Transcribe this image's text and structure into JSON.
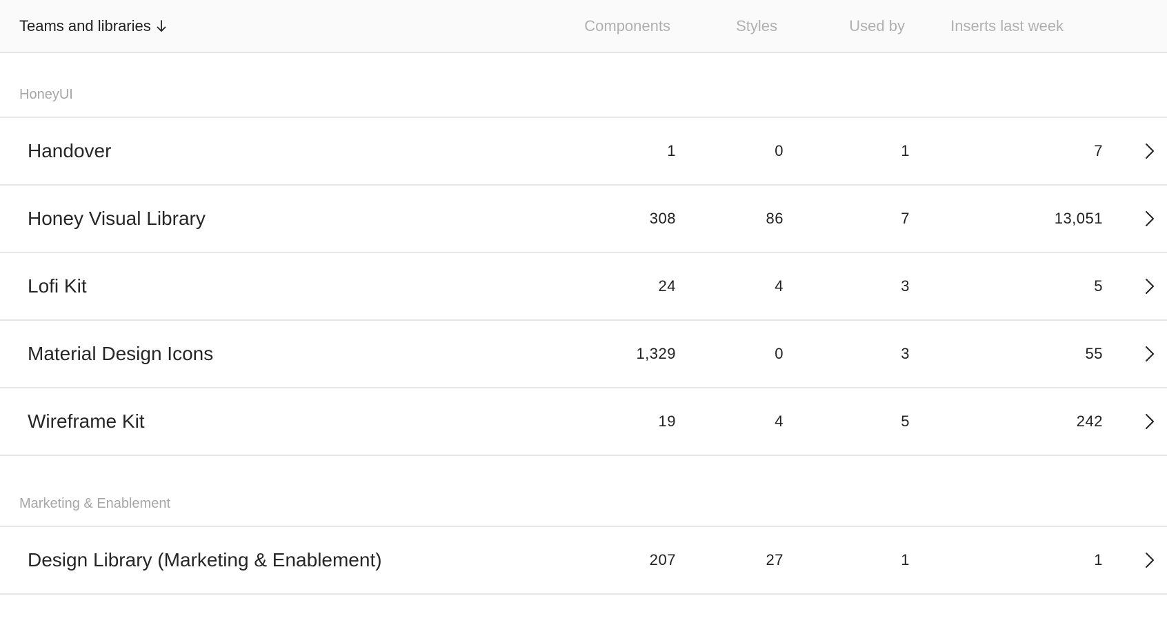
{
  "header": {
    "title": "Teams and libraries",
    "sort_icon": "arrow-down-icon",
    "columns": {
      "components": "Components",
      "styles": "Styles",
      "used_by": "Used by",
      "inserts": "Inserts last week"
    }
  },
  "groups": [
    {
      "label": "HoneyUI",
      "rows": [
        {
          "name": "Handover",
          "components": "1",
          "styles": "0",
          "used_by": "1",
          "inserts": "7"
        },
        {
          "name": "Honey Visual Library",
          "components": "308",
          "styles": "86",
          "used_by": "7",
          "inserts": "13,051"
        },
        {
          "name": "Lofi Kit",
          "components": "24",
          "styles": "4",
          "used_by": "3",
          "inserts": "5"
        },
        {
          "name": "Material Design Icons",
          "components": "1,329",
          "styles": "0",
          "used_by": "3",
          "inserts": "55"
        },
        {
          "name": "Wireframe Kit",
          "components": "19",
          "styles": "4",
          "used_by": "5",
          "inserts": "242"
        }
      ]
    },
    {
      "label": "Marketing & Enablement",
      "rows": [
        {
          "name": "Design Library (Marketing & Enablement)",
          "components": "207",
          "styles": "27",
          "used_by": "1",
          "inserts": "1"
        }
      ]
    }
  ],
  "icons": {
    "row_action": "chevron-right-icon"
  },
  "colors": {
    "muted_text": "#b0b0b0",
    "divider": "#e6e6e6",
    "header_bg": "#fafafa"
  }
}
